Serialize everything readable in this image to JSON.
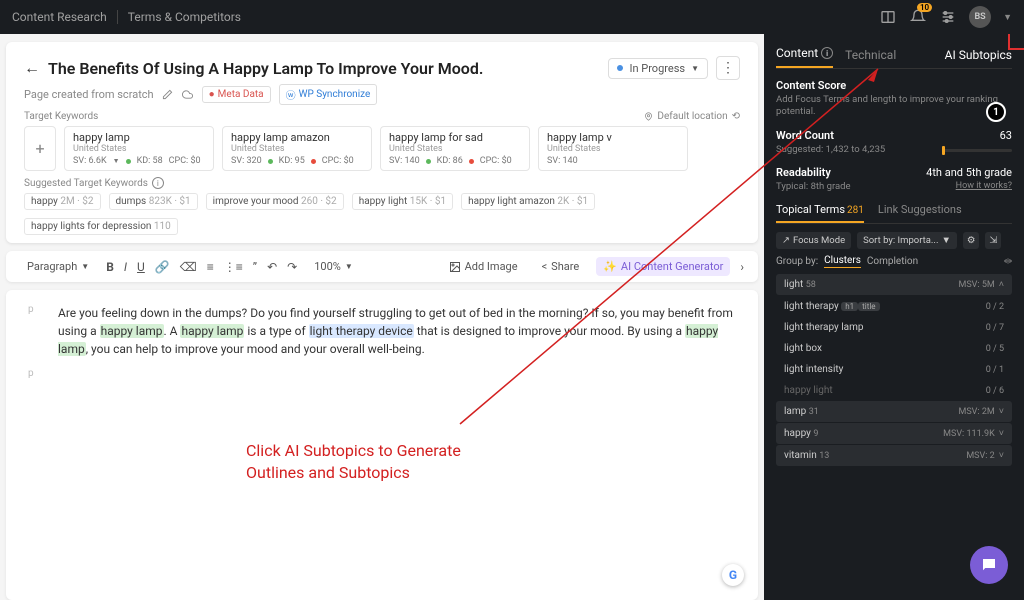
{
  "breadcrumb": {
    "a": "Content Research",
    "b": "Terms & Competitors"
  },
  "topbar": {
    "bell_count": "10",
    "avatar": "BS"
  },
  "page": {
    "title": "The Benefits Of Using A Happy Lamp To Improve Your Mood.",
    "status": "In Progress",
    "subtitle": "Page created from scratch",
    "meta_data": "Meta Data",
    "wp_sync": "WP Synchronize",
    "target_keywords_label": "Target Keywords",
    "location": "Default location",
    "suggested_label": "Suggested Target Keywords"
  },
  "keywords": [
    {
      "title": "happy lamp",
      "loc": "United States",
      "sv": "SV: 6.6K",
      "kd": "KD: 58",
      "kd_color": "g",
      "cpc": "CPC: $0"
    },
    {
      "title": "happy lamp amazon",
      "loc": "United States",
      "sv": "SV: 320",
      "kd": "KD: 95",
      "kd_color": "r",
      "cpc": "CPC: $0"
    },
    {
      "title": "happy lamp for sad",
      "loc": "United States",
      "sv": "SV: 140",
      "kd": "KD: 86",
      "kd_color": "r",
      "cpc": "CPC: $0"
    },
    {
      "title": "happy lamp v",
      "loc": "United States",
      "sv": "SV: 140",
      "kd": "",
      "kd_color": "g",
      "cpc": ""
    }
  ],
  "suggested": [
    {
      "t": "happy",
      "m": "2M · $2"
    },
    {
      "t": "dumps",
      "m": "823K · $1"
    },
    {
      "t": "improve your mood",
      "m": "260 · $2"
    },
    {
      "t": "happy light",
      "m": "15K · $1"
    },
    {
      "t": "happy light amazon",
      "m": "2K · $1"
    },
    {
      "t": "happy lights for depression",
      "m": "110"
    }
  ],
  "toolbar": {
    "paragraph": "Paragraph",
    "zoom": "100%",
    "add_image": "Add Image",
    "share": "Share",
    "ai_gen": "AI Content Generator"
  },
  "content": {
    "p1_a": "Are you feeling down in the dumps? Do you find yourself struggling to get out of bed in the morning? If so, you may benefit from using a ",
    "p1_h1": "happy lamp",
    "p1_b": ". A ",
    "p1_h2": "happy lamp",
    "p1_c": " is a type of ",
    "p1_h3": "light therapy device",
    "p1_d": " that is designed to improve your mood. By using a ",
    "p1_h4": "happy lamp",
    "p1_e": ", you can help to improve your mood and your overall well-being."
  },
  "annotation": {
    "line1": "Click AI Subtopics to Generate",
    "line2": "Outlines and Subtopics"
  },
  "side": {
    "tabs": {
      "content": "Content",
      "technical": "Technical",
      "ai": "AI Subtopics"
    },
    "content_score": "Content Score",
    "content_score_sub": "Add Focus Terms and length to improve your ranking potential.",
    "word_count_label": "Word Count",
    "word_count_val": "63",
    "word_count_sub": "Suggested: 1,432 to 4,235",
    "readability_label": "Readability",
    "readability_val": "4th and 5th grade",
    "readability_sub": "Typical: 8th grade",
    "how_it_works": "How it works?",
    "topical_terms": "Topical Terms",
    "topical_count": "281",
    "link_suggestions": "Link Suggestions",
    "focus_mode": "Focus Mode",
    "sort_by": "Sort by: Importa...",
    "group_by": "Group by:",
    "clusters": "Clusters",
    "completion": "Completion",
    "tooltip_step": "1"
  },
  "terms": [
    {
      "type": "header",
      "name": "light",
      "count": "58",
      "right": "MSV: 5M",
      "chev": "up"
    },
    {
      "type": "item",
      "name": "light therapy",
      "pills": [
        "h1",
        "title"
      ],
      "right": "0 / 2"
    },
    {
      "type": "item",
      "name": "light therapy lamp",
      "right": "0 / 7"
    },
    {
      "type": "item",
      "name": "light box",
      "right": "0 / 5"
    },
    {
      "type": "item",
      "name": "light intensity",
      "right": "0 / 1"
    },
    {
      "type": "item",
      "name": "happy light",
      "right": "0 / 6",
      "muted": true
    },
    {
      "type": "header",
      "name": "lamp",
      "count": "31",
      "right": "MSV: 2M",
      "chev": "down"
    },
    {
      "type": "header",
      "name": "happy",
      "count": "9",
      "right": "MSV: 111.9K",
      "chev": "down"
    },
    {
      "type": "header",
      "name": "vitamin",
      "count": "13",
      "right": "MSV: 2",
      "chev": "down"
    }
  ]
}
